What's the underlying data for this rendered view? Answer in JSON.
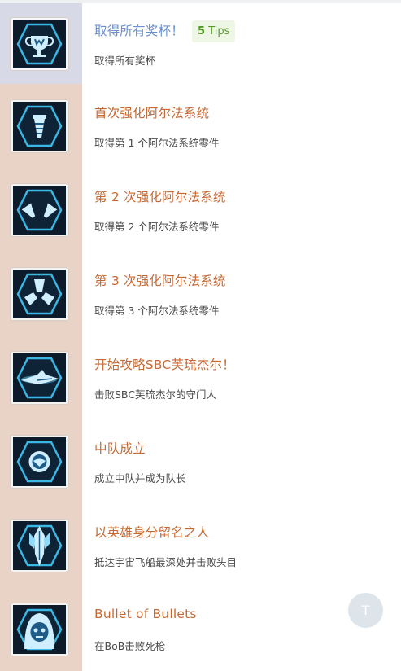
{
  "achievements": [
    {
      "title": "取得所有奖杯！",
      "description": "取得所有奖杯",
      "icon": "trophy-icon"
    },
    {
      "title": "首次强化阿尔法系统",
      "description": "取得第 1 个阿尔法系统零件",
      "icon": "alpha-part-1-icon"
    },
    {
      "title": "第 2 次强化阿尔法系统",
      "description": "取得第 2 个阿尔法系统零件",
      "icon": "alpha-part-2-icon"
    },
    {
      "title": "第 3 次强化阿尔法系统",
      "description": "取得第 3 个阿尔法系统零件",
      "icon": "alpha-part-3-icon"
    },
    {
      "title": "开始攻略SBC芙琉杰尔！",
      "description": "击败SBC芙琉杰尔的守门人",
      "icon": "starship-icon"
    },
    {
      "title": "中队成立",
      "description": "成立中队并成为队长",
      "icon": "squad-emblem-icon"
    },
    {
      "title": "以英雄身分留名之人",
      "description": "抵达宇宙飞船最深处并击败头目",
      "icon": "boss-crystal-icon"
    },
    {
      "title": "Bullet of Bullets",
      "description": "在BoB击败死枪",
      "icon": "hooded-skull-icon"
    }
  ],
  "tips_badge": {
    "count": "5",
    "label": "Tips"
  },
  "back_to_top": {
    "label": "T"
  },
  "colors": {
    "title_blue": "#6b8fcf",
    "title_orange": "#c66a35",
    "tips_green": "#4e9a1e",
    "side_peach": "#e9d2c6",
    "side_lavender": "#d8d9e6"
  }
}
